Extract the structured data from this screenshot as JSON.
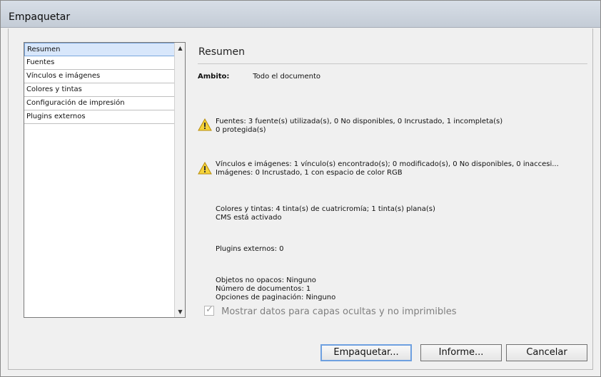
{
  "window": {
    "title": "Empaquetar"
  },
  "sidebar": {
    "items": [
      {
        "label": "Resumen",
        "selected": true
      },
      {
        "label": "Fuentes",
        "selected": false
      },
      {
        "label": "Vínculos e imágenes",
        "selected": false
      },
      {
        "label": "Colores y tintas",
        "selected": false
      },
      {
        "label": "Configuración de impresión",
        "selected": false
      },
      {
        "label": "Plugins externos",
        "selected": false
      }
    ]
  },
  "summary": {
    "title": "Resumen",
    "ambito_label": "Ambito:",
    "ambito_value": "Todo el documento",
    "fuentes": {
      "line1": "Fuentes: 3 fuente(s) utilizada(s), 0 No disponibles, 0 Incrustado, 1 incompleta(s)",
      "line2": "0 protegida(s)"
    },
    "vinculos": {
      "line1": "Vínculos e imágenes: 1 vínculo(s) encontrado(s); 0 modificado(s), 0 No disponibles, 0 inaccesi...",
      "line2": "Imágenes: 0 Incrustado, 1 con espacio de color RGB"
    },
    "colores": {
      "line1": "Colores y tintas: 4 tinta(s) de cuatricromía; 1 tinta(s) plana(s)",
      "line2": "CMS está activado"
    },
    "plugins": {
      "line1": "Plugins externos: 0"
    },
    "otros": {
      "line1": "Objetos no opacos: Ninguno",
      "line2": "Número de documentos: 1",
      "line3": "Opciones de paginación: Ninguno"
    }
  },
  "checkbox": {
    "label": "Mostrar datos para capas ocultas y no imprimibles",
    "checked": true
  },
  "buttons": {
    "package": "Empaquetar...",
    "report": "Informe...",
    "cancel": "Cancelar"
  },
  "icons": {
    "warning": "warning-icon",
    "scroll_up": "arrow-up-icon",
    "scroll_down": "arrow-down-icon"
  }
}
